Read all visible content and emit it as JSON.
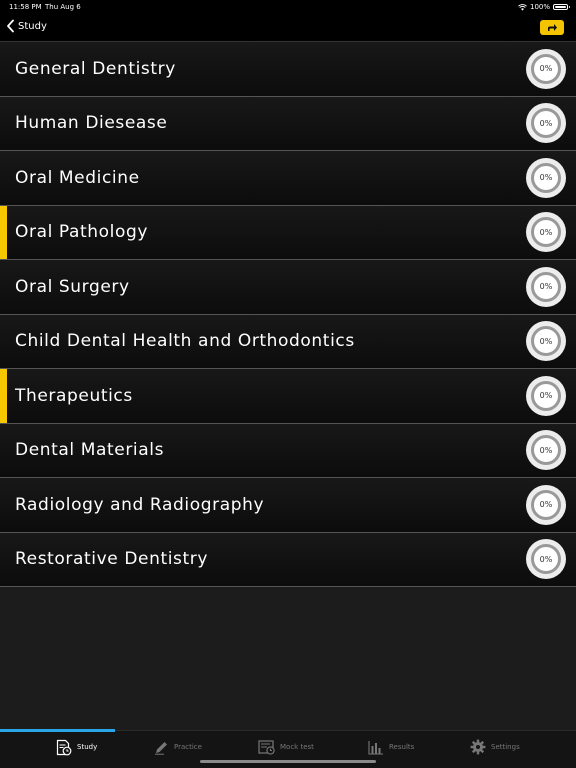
{
  "status": {
    "time": "11:58 PM",
    "date": "Thu Aug 6",
    "battery": "100%"
  },
  "nav": {
    "back_label": "Study"
  },
  "colors": {
    "accent": "#f7c800",
    "tab_indicator": "#2aa6e8"
  },
  "subjects": [
    {
      "label": "General Dentistry",
      "progress": "0%",
      "highlight": false
    },
    {
      "label": "Human Diesease",
      "progress": "0%",
      "highlight": false
    },
    {
      "label": "Oral Medicine",
      "progress": "0%",
      "highlight": false
    },
    {
      "label": "Oral Pathology",
      "progress": "0%",
      "highlight": true
    },
    {
      "label": "Oral Surgery",
      "progress": "0%",
      "highlight": false
    },
    {
      "label": "Child Dental Health and Orthodontics",
      "progress": "0%",
      "highlight": false
    },
    {
      "label": "Therapeutics",
      "progress": "0%",
      "highlight": true
    },
    {
      "label": "Dental Materials",
      "progress": "0%",
      "highlight": false
    },
    {
      "label": "Radiology and Radiography",
      "progress": "0%",
      "highlight": false
    },
    {
      "label": "Restorative Dentistry",
      "progress": "0%",
      "highlight": false
    }
  ],
  "tabs": [
    {
      "label": "Study",
      "icon": "study-icon",
      "active": true
    },
    {
      "label": "Practice",
      "icon": "pencil-icon",
      "active": false
    },
    {
      "label": "Mock test",
      "icon": "mock-test-icon",
      "active": false
    },
    {
      "label": "Results",
      "icon": "bar-chart-icon",
      "active": false
    },
    {
      "label": "Settings",
      "icon": "gear-icon",
      "active": false
    }
  ]
}
